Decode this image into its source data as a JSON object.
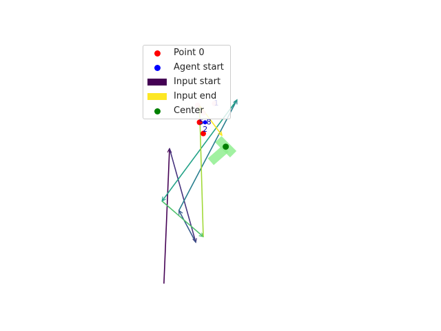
{
  "chart_data": {
    "type": "line",
    "title": "",
    "xlabel": "",
    "ylabel": "",
    "axes_visible": false,
    "xlim": [
      -1.0,
      1.0
    ],
    "ylim": [
      -1.0,
      1.0
    ],
    "legend": {
      "placement": "top-center",
      "entries": [
        {
          "label": "Point 0",
          "marker": "dot",
          "color": "#ff0000"
        },
        {
          "label": "Agent start",
          "marker": "dot",
          "color": "#0000ff"
        },
        {
          "label": "Input start",
          "marker": "patch",
          "color": "#440154"
        },
        {
          "label": "Input end",
          "marker": "patch",
          "color": "#fde725"
        },
        {
          "label": "Center",
          "marker": "dot",
          "color": "#008000"
        }
      ]
    },
    "input_path": {
      "colormap": "viridis",
      "points": [
        [
          -0.21,
          -0.74
        ],
        [
          -0.18,
          -0.02
        ],
        [
          -0.04,
          -0.52
        ],
        [
          -0.13,
          -0.35
        ],
        [
          0.18,
          0.24
        ],
        [
          -0.22,
          -0.3
        ],
        [
          0.0,
          -0.49
        ],
        [
          -0.02,
          0.21
        ],
        [
          0.1,
          0.05
        ]
      ]
    },
    "center_shape": {
      "color": "#90ee90",
      "center": [
        0.12,
        -0.01
      ],
      "bars": [
        {
          "from": [
            0.08,
            0.03
          ],
          "to": [
            0.16,
            -0.05
          ]
        },
        {
          "from": [
            0.04,
            -0.09
          ],
          "to": [
            0.12,
            -0.02
          ]
        }
      ]
    },
    "center": {
      "x": 0.12,
      "y": -0.01,
      "label": "Center"
    },
    "red_points": [
      {
        "x": -0.02,
        "y": 0.12
      },
      {
        "x": 0.0,
        "y": 0.06
      }
    ],
    "pink_points": [
      {
        "x": -0.03,
        "y": 0.21
      },
      {
        "x": 0.06,
        "y": 0.22
      },
      {
        "x": 0.0,
        "y": 0.17
      }
    ],
    "agent_start": {
      "x": 0.01,
      "y": 0.12
    },
    "point_labels": [
      {
        "text": "5",
        "x": -0.01,
        "y": 0.12
      },
      {
        "text": "8",
        "x": 0.03,
        "y": 0.12
      },
      {
        "text": "2",
        "x": 0.01,
        "y": 0.08
      },
      {
        "text": "1",
        "x": 0.07,
        "y": 0.22
      }
    ]
  }
}
